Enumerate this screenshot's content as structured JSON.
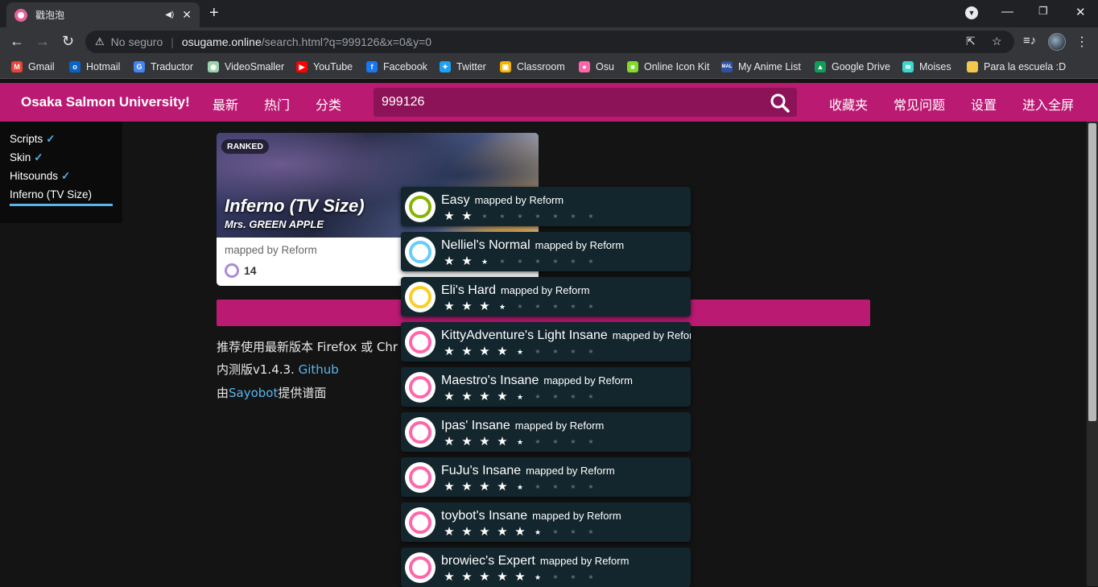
{
  "browser": {
    "tab_title": "戳泡泡",
    "new_tab_label": "+",
    "security_label": "No seguro",
    "url_host": "osugame.online",
    "url_path": "/search.html?q=999126&x=0&y=0",
    "bookmarks": [
      {
        "label": "Gmail",
        "icon": "gmail-icon",
        "color": "#ea4335"
      },
      {
        "label": "Hotmail",
        "icon": "outlook-icon",
        "color": "#0a64c8"
      },
      {
        "label": "Traductor",
        "icon": "translate-icon",
        "color": "#4285f4"
      },
      {
        "label": "VideoSmaller",
        "icon": "videosmaller-icon",
        "color": "#9bd3ae"
      },
      {
        "label": "YouTube",
        "icon": "youtube-icon",
        "color": "#ff0000"
      },
      {
        "label": "Facebook",
        "icon": "facebook-icon",
        "color": "#1877f2"
      },
      {
        "label": "Twitter",
        "icon": "twitter-icon",
        "color": "#1da1f2"
      },
      {
        "label": "Classroom",
        "icon": "classroom-icon",
        "color": "#f4b400"
      },
      {
        "label": "Osu",
        "icon": "osu-icon",
        "color": "#ff66aa"
      },
      {
        "label": "Online Icon Kit",
        "icon": "iconkit-icon",
        "color": "#7fdc2a"
      },
      {
        "label": "My Anime List",
        "icon": "mal-icon",
        "color": "#2e51a2"
      },
      {
        "label": "Google Drive",
        "icon": "drive-icon",
        "color": "#0f9d58"
      },
      {
        "label": "Moises",
        "icon": "moises-icon",
        "color": "#3ad6d0"
      },
      {
        "label": "Para la escuela :D",
        "icon": "folder-icon",
        "color": "#f2c94c"
      }
    ]
  },
  "site": {
    "brand": "Osaka Salmon University!",
    "nav": [
      "最新",
      "热门",
      "分类"
    ],
    "search_value": "999126",
    "nav_right": [
      "收藏夹",
      "常见问题",
      "设置",
      "进入全屏"
    ],
    "accent": "#bb1a73"
  },
  "sidepanel": {
    "items": [
      {
        "label": "Scripts",
        "checked": "✓"
      },
      {
        "label": "Skin",
        "checked": "✓"
      },
      {
        "label": "Hitsounds",
        "checked": "✓"
      },
      {
        "label": "Inferno (TV Size)",
        "checked": ""
      }
    ]
  },
  "card": {
    "status": "RANKED",
    "title": "Inferno (TV Size)",
    "artist": "Mrs. GREEN APPLE",
    "mapper": "mapped by Reform",
    "difficulty_count": "14"
  },
  "info": {
    "line1": "推荐使用最新版本 Firefox 或 Chr",
    "line2_prefix": "内测版v1.4.3. ",
    "line2_link": "Github",
    "line3_prefix": "由",
    "line3_link": "Sayobot",
    "line3_suffix": "提供谱面"
  },
  "difficulties": [
    {
      "name": "Easy",
      "mapper": "mapped by Reform",
      "ring_color": "#88b300",
      "stars": 2.0
    },
    {
      "name": "Nelliel's Normal",
      "mapper": "mapped by Reform",
      "ring_color": "#66ccff",
      "stars": 2.5
    },
    {
      "name": "Eli's Hard",
      "mapper": "mapped by Reform",
      "ring_color": "#ffcc22",
      "stars": 3.7
    },
    {
      "name": "KittyAdventure's Light Insane",
      "mapper": "mapped by Reform",
      "ring_color": "#ff66aa",
      "stars": 4.5
    },
    {
      "name": "Maestro's Insane",
      "mapper": "mapped by Reform",
      "ring_color": "#ff66aa",
      "stars": 4.8
    },
    {
      "name": "Ipas' Insane",
      "mapper": "mapped by Reform",
      "ring_color": "#ff66aa",
      "stars": 4.9
    },
    {
      "name": "FuJu's Insane",
      "mapper": "mapped by Reform",
      "ring_color": "#ff66aa",
      "stars": 4.9
    },
    {
      "name": "toybot's Insane",
      "mapper": "mapped by Reform",
      "ring_color": "#ff66aa",
      "stars": 5.4
    },
    {
      "name": "browiec's Expert",
      "mapper": "mapped by Reform",
      "ring_color": "#ff66aa",
      "stars": 5.5
    }
  ]
}
